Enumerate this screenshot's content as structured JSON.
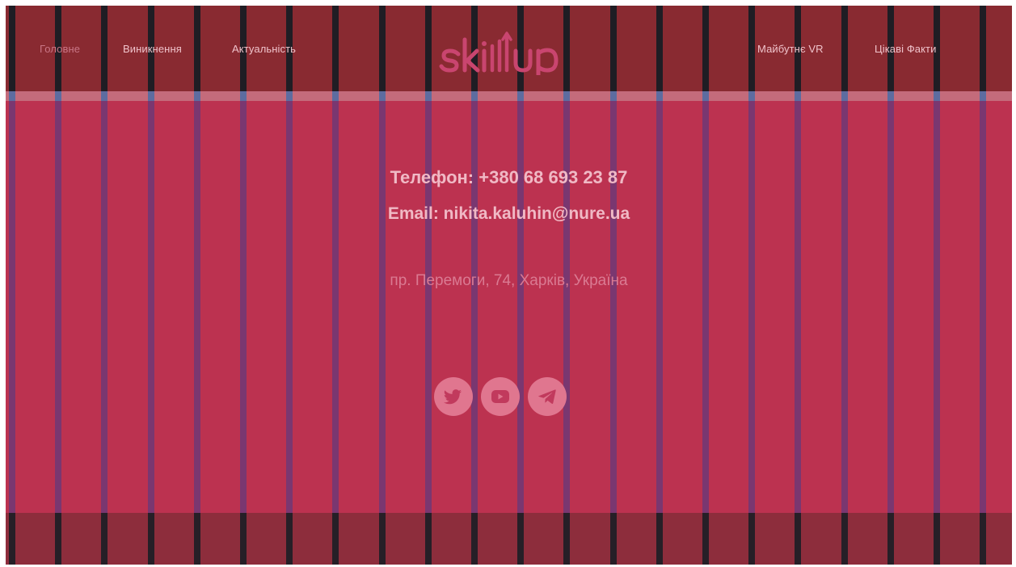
{
  "nav": {
    "left": [
      "Головне",
      "Виникнення",
      "Актуальність"
    ],
    "right": [
      "Майбутнє VR",
      "Цікаві Факти"
    ]
  },
  "logo": {
    "text": "skillup"
  },
  "contact": {
    "phone": "Телефон: +380 68 693 23 87",
    "email": "Email: nikita.kaluhin@nure.ua",
    "address": "пр. Перемоги, 74, Харків, Україна"
  },
  "socials": [
    {
      "icon": "twitter-icon"
    },
    {
      "icon": "youtube-icon"
    },
    {
      "icon": "telegram-icon"
    }
  ],
  "colors": {
    "header": "#892a31",
    "main": "#bc3250",
    "footer": "#8d2d3c",
    "accent": "#e0768f"
  }
}
